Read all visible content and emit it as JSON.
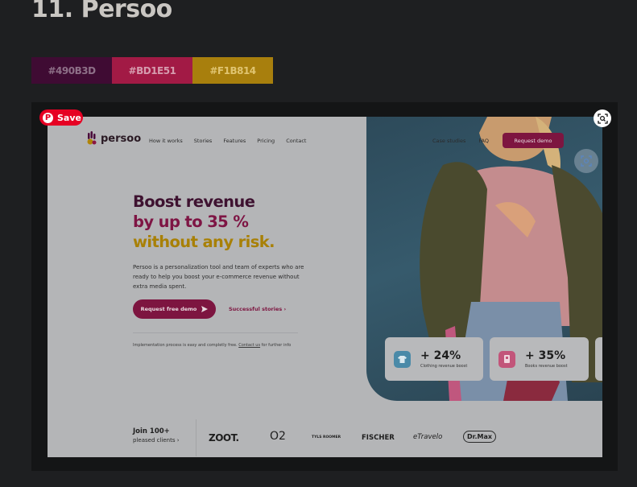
{
  "heading": "11. Persoo",
  "swatches": [
    {
      "label": "#490B3D",
      "bg": "#3f0b33",
      "fg": "#8e7088"
    },
    {
      "label": "#BD1E51",
      "bg": "#a21a45",
      "fg": "#d69cae"
    },
    {
      "label": "#F1B814",
      "bg": "#a87f0d",
      "fg": "#e0c470"
    }
  ],
  "pin": {
    "save_label": "Save",
    "logo": "P"
  },
  "site": {
    "logo_text": "persoo",
    "nav": [
      "How it works",
      "Stories",
      "Features",
      "Pricing",
      "Contact"
    ],
    "nav_right": [
      "Case studies",
      "FAQ"
    ],
    "request_demo": "Request demo",
    "hero": {
      "line1": "Boost revenue",
      "line2": "by up to 35 %",
      "line3": "without any risk.",
      "description": "Persoo is a personalization tool and team of experts who are ready to help you boost your e-commerce revenue without extra media spent.",
      "cta_primary": "Request free demo",
      "cta_secondary": "Successful stories",
      "note_prefix": "Implementation process is easy and completly free.",
      "note_link": "Contact us",
      "note_suffix": "for further info"
    },
    "stats": [
      {
        "value": "+ 24%",
        "label": "Clothing revenue boost",
        "icon": "tshirt-icon",
        "color": "#4a8aa8"
      },
      {
        "value": "+ 35%",
        "label": "Books revenue boost",
        "icon": "book-icon",
        "color": "#c2557a"
      }
    ],
    "join": {
      "line1": "Join 100+",
      "line2": "pleased clients"
    },
    "brands": [
      "ZOOT.",
      "O2",
      "TYLS ROOMER",
      "FISCHER",
      "eTravelo",
      "Dr.Max"
    ]
  }
}
